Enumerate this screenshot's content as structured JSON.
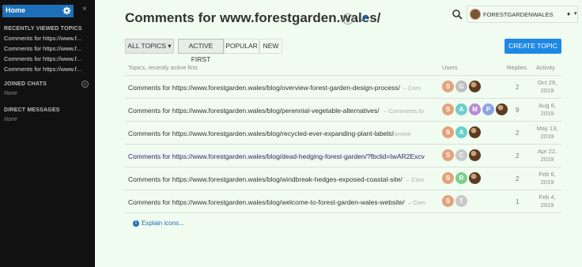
{
  "sidebar": {
    "home_label": "Home",
    "close_glyph": "×",
    "recent_heading": "RECENTLY VIEWED TOPICS",
    "recent_items": [
      "Comments for https://www.f...",
      "Comments for https://www.f...",
      "Comments for https://www.f...",
      "Comments for https://www.f..."
    ],
    "joined_heading": "JOINED CHATS",
    "joined_none": "None",
    "dm_heading": "DIRECT MESSAGES",
    "dm_none": "None"
  },
  "header": {
    "title": "Comments for www.forestgarden.wales/",
    "user_name": "FORESTGARDENWALES",
    "accent_color": "#1e88e5"
  },
  "toolbar": {
    "all_topics": "ALL TOPICS ▾",
    "tabs": [
      "ACTIVE FIRST",
      "POPULAR",
      "NEW"
    ],
    "create": "CREATE TOPIC"
  },
  "columns": {
    "topics": "Topics, recently active first",
    "users": "Users",
    "replies": "Replies",
    "activity": "Activity"
  },
  "rows": [
    {
      "title": "Comments for https://www.forestgarden.wales/blog/overview-forest-garden-design-process/",
      "excerpt": "– Com",
      "users": [
        "S",
        "G",
        "img"
      ],
      "replies": "2",
      "activity_1": "Oct 29,",
      "activity_2": "2019"
    },
    {
      "title": "Comments for https://www.forestgarden.wales/blog/perennial-vegetable-alternatives/",
      "excerpt": "– Comments fo",
      "users": [
        "S",
        "A",
        "M",
        "P",
        "img"
      ],
      "replies": "9",
      "activity_1": "Aug 8,",
      "activity_2": "2019"
    },
    {
      "title": "Comments for https://www.forestgarden.wales/blog/recycled-ever-expanding-plant-labels/",
      "excerpt": "– Comme",
      "users": [
        "S",
        "A",
        "img"
      ],
      "replies": "2",
      "activity_1": "May 13,",
      "activity_2": "2019"
    },
    {
      "title": "Comments for https://www.forestgarden.wales/blog/dead-hedging-forest-garden/?fbclid=IwAR2Excv",
      "excerpt": "",
      "users": [
        "S",
        "C",
        "img"
      ],
      "replies": "2",
      "activity_1": "Apr 22,",
      "activity_2": "2019"
    },
    {
      "title": "Comments for https://www.forestgarden.wales/blog/windbreak-hedges-exposed-coastal-site/",
      "excerpt": "– Com",
      "users": [
        "S",
        "R",
        "img"
      ],
      "replies": "2",
      "activity_1": "Feb 6,",
      "activity_2": "2019"
    },
    {
      "title": "Comments for https://www.forestgarden.wales/blog/welcome-to-forest-garden-wales-website/",
      "excerpt": "– Com",
      "users": [
        "S",
        "T"
      ],
      "replies": "1",
      "activity_1": "Feb 4,",
      "activity_2": "2019"
    }
  ],
  "explain": "Explain icons..."
}
